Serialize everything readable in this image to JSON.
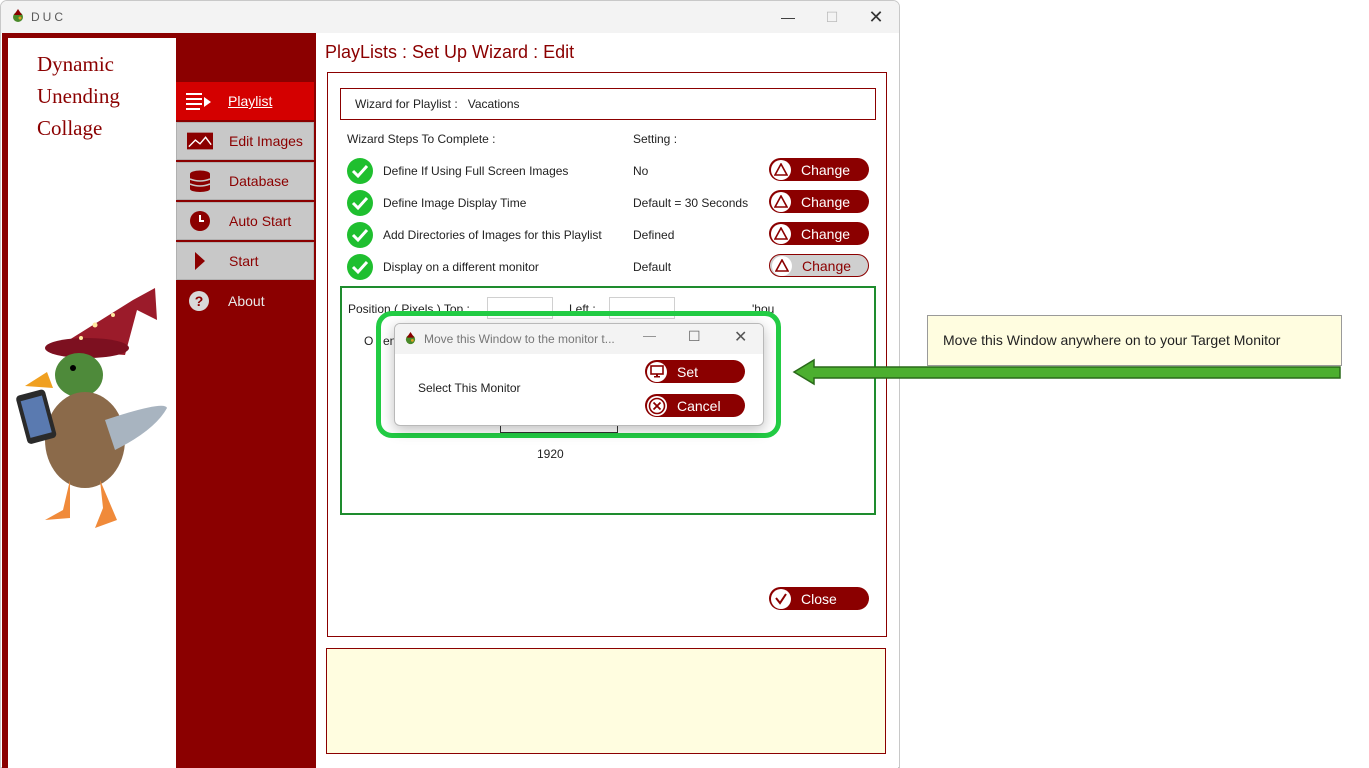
{
  "window": {
    "title": "DUC"
  },
  "brand": {
    "text": "Dynamic\nUnending\nCollage"
  },
  "nav": {
    "items": [
      {
        "label": "Playlist",
        "icon": "playlist-icon"
      },
      {
        "label": "Edit Images",
        "icon": "image-icon"
      },
      {
        "label": "Database",
        "icon": "database-icon"
      },
      {
        "label": "Auto Start",
        "icon": "clock-icon"
      },
      {
        "label": "Start",
        "icon": "play-icon"
      },
      {
        "label": "About",
        "icon": "help-icon"
      }
    ]
  },
  "page": {
    "title": "PlayLists : Set Up Wizard : Edit",
    "playlist_label": "Wizard for Playlist :",
    "playlist_name": "Vacations",
    "steps_header": "Wizard Steps To Complete :",
    "setting_header": "Setting :",
    "steps": [
      {
        "label": "Define If Using Full Screen Images",
        "setting": "No",
        "button": "Change"
      },
      {
        "label": "Define Image Display Time",
        "setting": "Default = 30 Seconds",
        "button": "Change"
      },
      {
        "label": "Add Directories of Images for this Playlist",
        "setting": "Defined",
        "button": "Change"
      },
      {
        "label": "Display on a different monitor",
        "setting": "Default",
        "button": "Change"
      }
    ],
    "monitor": {
      "position_label": "Position ( Pixels )  Top :",
      "left_label": "Left :",
      "partial_right": "'hou",
      "partial_left": "O",
      "partial_left2": "en",
      "width_value": "1920"
    },
    "close_label": "Close"
  },
  "popup": {
    "title": "Move this Window to the monitor t...",
    "prompt": "Select This Monitor",
    "set_label": "Set",
    "cancel_label": "Cancel"
  },
  "callout": {
    "text": "Move this Window anywhere on to your Target Monitor"
  },
  "colors": {
    "brand": "#8b0000",
    "accent": "#d40000",
    "highlight": "#22cc44",
    "check": "#1fbf2f",
    "arrow": "#4caf2f"
  }
}
